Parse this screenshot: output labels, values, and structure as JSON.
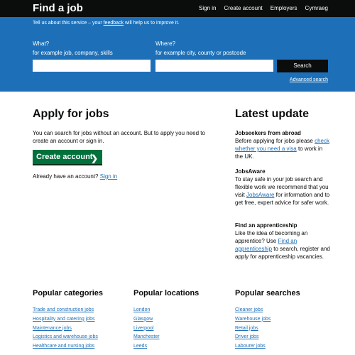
{
  "header": {
    "logo": "Find a job",
    "nav": [
      "Sign in",
      "Create account",
      "Employers",
      "Cymraeg"
    ]
  },
  "feedback": {
    "before": "Tell us about this service – your ",
    "link": "feedback",
    "after": " will help us to improve it."
  },
  "search": {
    "what_label": "What?",
    "what_hint": "for example job, company, skills",
    "what_value": "",
    "where_label": "Where?",
    "where_hint": "for example city, county or postcode",
    "where_value": "",
    "button": "Search",
    "advanced": "Advanced search"
  },
  "apply": {
    "title": "Apply for jobs",
    "text": "You can search for jobs without an account. But to apply you need to create an account or sign in.",
    "create_button": "Create account",
    "already_text": "Already have an account? ",
    "sign_in": "Sign in"
  },
  "latest": {
    "title": "Latest update",
    "items": [
      {
        "heading": "Jobseekers from abroad",
        "before": "Before applying for jobs please ",
        "link": "check whether you need a visa",
        "after": " to work in the UK."
      },
      {
        "heading": "JobsAware",
        "before": "To stay safe in your job search and flexible work we recommend that you visit ",
        "link": "JobsAware",
        "after": " for information and to get free, expert advice for safer work."
      },
      {
        "heading": "Find an apprenticeship",
        "before": "Like the idea of becoming an apprentice? Use ",
        "link": "Find an apprenticeship",
        "after": " to search, register and apply for apprenticeship vacancies."
      }
    ]
  },
  "popular": {
    "categories": {
      "title": "Popular categories",
      "links": [
        "Trade and construction jobs",
        "Hospitality and catering jobs",
        "Maintenance jobs",
        "Logistics and warehouse jobs",
        "Healthcare and nursing jobs"
      ]
    },
    "locations": {
      "title": "Popular locations",
      "links": [
        "London",
        "Glasgow",
        "Liverpool",
        "Manchester",
        "Leeds"
      ]
    },
    "searches": {
      "title": "Popular searches",
      "links": [
        "Cleaner jobs",
        "Warehouse jobs",
        "Retail jobs",
        "Driver jobs",
        "Labourer jobs"
      ]
    }
  },
  "colors": {
    "header": "#0b0c0c",
    "brand_blue": "#1d70b8",
    "button_green": "#00703c",
    "link": "#1d70b8"
  }
}
